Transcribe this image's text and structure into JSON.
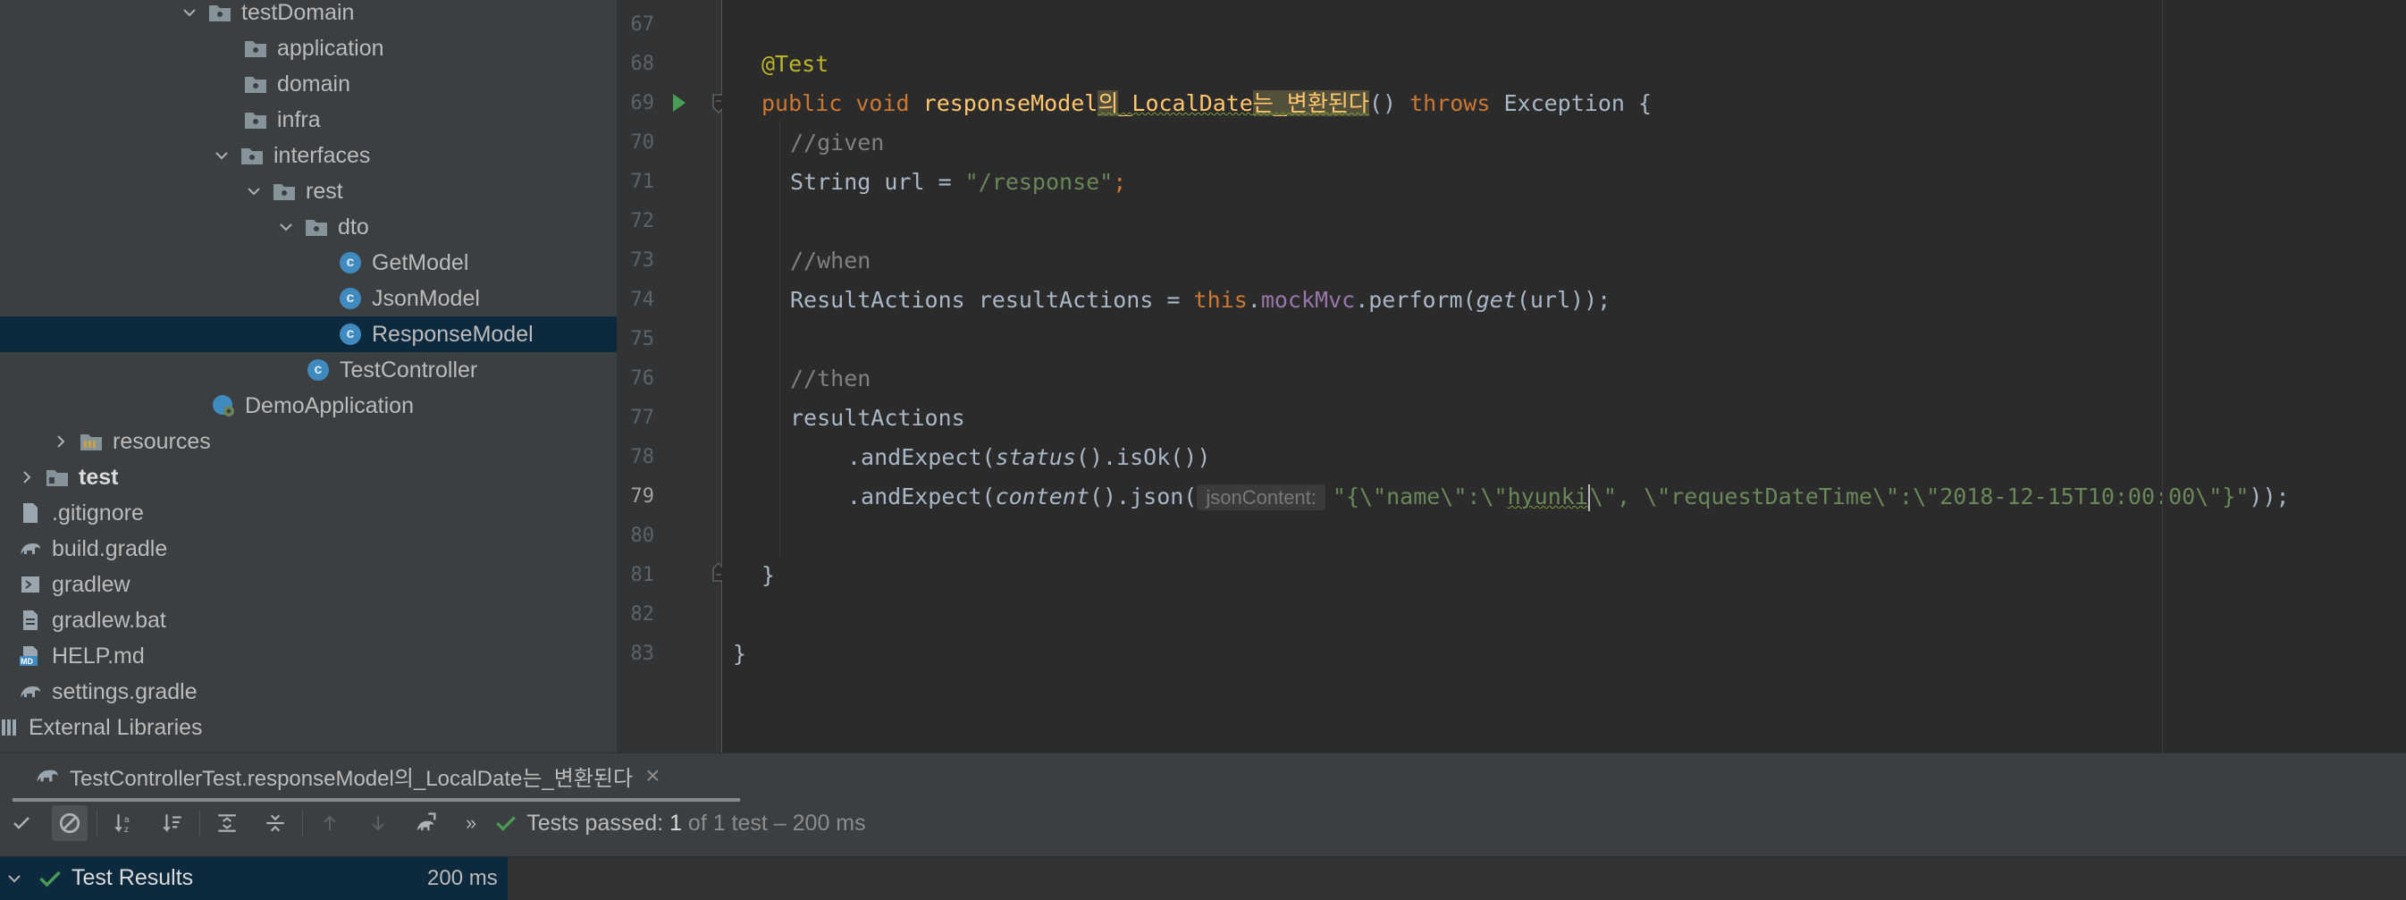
{
  "project_tree": {
    "items": [
      {
        "label": "testDomain",
        "arrow": "down"
      },
      {
        "label": "application"
      },
      {
        "label": "domain"
      },
      {
        "label": "infra"
      },
      {
        "label": "interfaces",
        "arrow": "down"
      },
      {
        "label": "rest",
        "arrow": "down"
      },
      {
        "label": "dto",
        "arrow": "down"
      },
      {
        "label": "GetModel",
        "icon": "class-icon"
      },
      {
        "label": "JsonModel",
        "icon": "class-icon"
      },
      {
        "label": "ResponseModel",
        "icon": "class-icon",
        "selected": true
      },
      {
        "label": "TestController",
        "icon": "class-icon"
      },
      {
        "label": "DemoApplication",
        "icon": "spring-app-icon"
      },
      {
        "label": "resources",
        "arrow": "right"
      },
      {
        "label": "test",
        "arrow": "right",
        "bold": true
      },
      {
        "label": ".gitignore"
      },
      {
        "label": "build.gradle"
      },
      {
        "label": "gradlew"
      },
      {
        "label": "gradlew.bat"
      },
      {
        "label": "HELP.md"
      },
      {
        "label": "settings.gradle"
      },
      {
        "label": "External Libraries"
      }
    ],
    "class_badge": "c",
    "md_badge": "MD"
  },
  "editor": {
    "line_numbers": [
      "67",
      "68",
      "69",
      "70",
      "71",
      "72",
      "73",
      "74",
      "75",
      "76",
      "77",
      "78",
      "79",
      "80",
      "81",
      "82",
      "83"
    ],
    "current_line": "79",
    "code": {
      "l68_annotation": "@Test",
      "l69_public": "public",
      "l69_void": "void",
      "l69_m1": "responseModel",
      "l69_m2": "의",
      "l69_m3": "_LocalDate",
      "l69_m4": "는_변환된다",
      "l69_parens": "()",
      "l69_throws": "throws",
      "l69_exception": "Exception {",
      "l70_comment": "//given",
      "l71_decl": "String url = ",
      "l71_str": "\"/response\"",
      "l71_semi": ";",
      "l73_comment": "//when",
      "l74_decl": "ResultActions resultActions = ",
      "l74_this": "this",
      "l74_dot": ".",
      "l74_field": "mockMvc",
      "l74_perform": ".perform(",
      "l74_get": "get",
      "l74_rest": "(url));",
      "l76_comment": "//then",
      "l77_text": "resultActions",
      "l78_pre": ".andExpect(",
      "l78_status": "status",
      "l78_post": "().isOk())",
      "l79_pre": ".andExpect(",
      "l79_content": "content",
      "l79_json": "().json(",
      "l79_hint": "jsonContent:",
      "l79_s1": "\"{\\\"name\\\":\\\"",
      "l79_s2": "hyunki",
      "l79_s3": "\\\", \\\"requestDateTime\\\":\\\"2018-12-15T10:00:00\\\"}\"",
      "l79_end": "));",
      "l81_brace": "}",
      "l83_brace": "}"
    }
  },
  "run_panel": {
    "tab_title": "TestControllerTest.responseModel의_LocalDate는_변환된다",
    "tab_close": "×",
    "status_prefix": "Tests passed: ",
    "status_count": "1",
    "status_suffix": " of 1 test – 200 ms",
    "results_label": "Test Results",
    "results_time": "200 ms"
  },
  "colors": {
    "accent_green": "#499c54",
    "selection": "#0d293e",
    "class_icon": "#3f8bc0"
  }
}
